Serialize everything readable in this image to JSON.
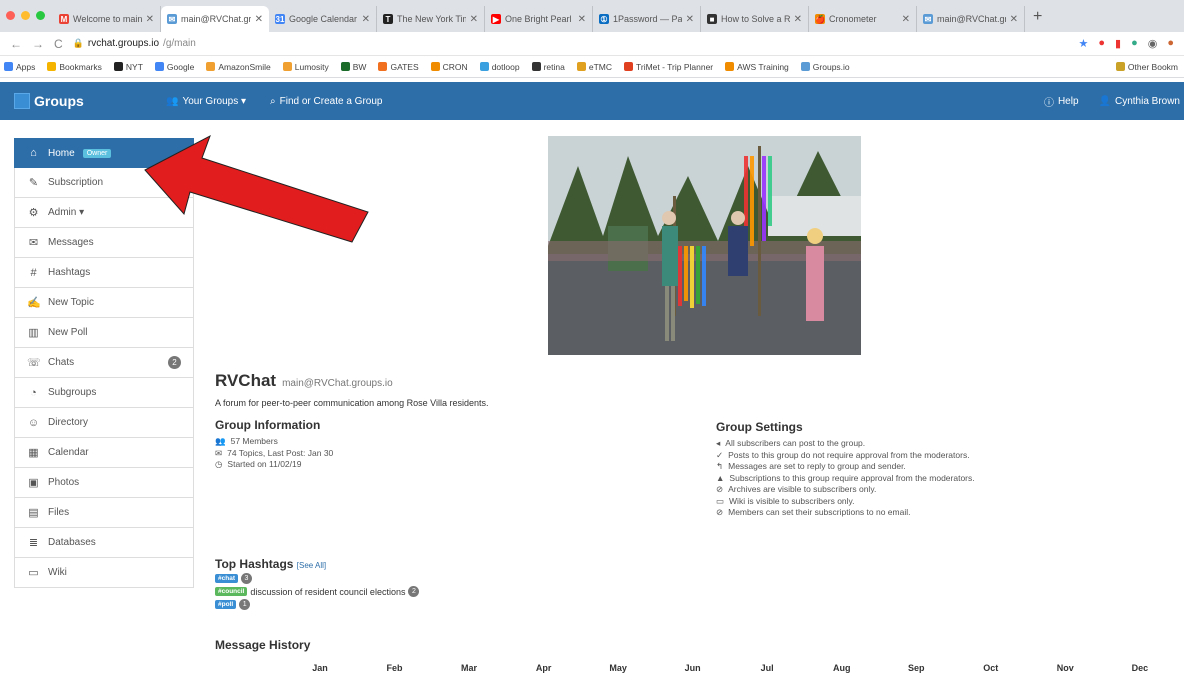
{
  "browser": {
    "tabs": [
      {
        "title": "Welcome to main@",
        "fav": "M",
        "color": "#ea4335",
        "active": false
      },
      {
        "title": "main@RVChat.gro",
        "fav": "✉",
        "color": "#5b9bd5",
        "active": true
      },
      {
        "title": "Google Calendar -",
        "fav": "31",
        "color": "#4285f4",
        "active": false
      },
      {
        "title": "The New York Tim",
        "fav": "T",
        "color": "#222222",
        "active": false
      },
      {
        "title": "One Bright Pearl -",
        "fav": "▶",
        "color": "#ff0000",
        "active": false
      },
      {
        "title": "1Password — Pass",
        "fav": "①",
        "color": "#0a6dc2",
        "active": false
      },
      {
        "title": "How to Solve a Ru",
        "fav": "■",
        "color": "#333333",
        "active": false
      },
      {
        "title": "Cronometer",
        "fav": "🍎",
        "color": "#f08c00",
        "active": false
      },
      {
        "title": "main@RVChat.gro",
        "fav": "✉",
        "color": "#5b9bd5",
        "active": false
      }
    ],
    "url_host": "rvchat.groups.io",
    "url_path": "/g/main",
    "bookmarks": [
      {
        "label": "Apps",
        "color": "#4285f4"
      },
      {
        "label": "Bookmarks",
        "color": "#f4b400"
      },
      {
        "label": "NYT",
        "color": "#222222"
      },
      {
        "label": "Google",
        "color": "#4285f4"
      },
      {
        "label": "AmazonSmile",
        "color": "#f0a030"
      },
      {
        "label": "Lumosity",
        "color": "#f0a030"
      },
      {
        "label": "BW",
        "color": "#1a6a2a"
      },
      {
        "label": "GATES",
        "color": "#f07020"
      },
      {
        "label": "CRON",
        "color": "#f08c00"
      },
      {
        "label": "dotloop",
        "color": "#3aa0e0"
      },
      {
        "label": "retina",
        "color": "#333333"
      },
      {
        "label": "eTMC",
        "color": "#e0a020"
      },
      {
        "label": "TriMet - Trip Planner",
        "color": "#e04020"
      },
      {
        "label": "AWS Training",
        "color": "#f08c00"
      },
      {
        "label": "Groups.io",
        "color": "#5b9bd5"
      }
    ],
    "other_bookmarks": "Other Bookm"
  },
  "nav": {
    "logo": "Groups",
    "your_groups": "Your Groups ▾",
    "find_create": "Find or Create a Group",
    "help": "Help",
    "user": "Cynthia Brown"
  },
  "sidebar": {
    "items": [
      {
        "label": "Home",
        "icon": "home-icon",
        "glyph": "⌂",
        "badge": "Owner",
        "active": true
      },
      {
        "label": "Subscription",
        "icon": "pencil-icon",
        "glyph": "✎"
      },
      {
        "label": "Admin ▾",
        "icon": "cog-icon",
        "glyph": "⚙"
      },
      {
        "label": "Messages",
        "icon": "comments-icon",
        "glyph": "✉"
      },
      {
        "label": "Hashtags",
        "icon": "hashtag-icon",
        "glyph": "#"
      },
      {
        "label": "New Topic",
        "icon": "edit-icon",
        "glyph": "✍"
      },
      {
        "label": "New Poll",
        "icon": "chart-icon",
        "glyph": "▥"
      },
      {
        "label": "Chats",
        "icon": "chat-icon",
        "glyph": "☏",
        "count": "2"
      },
      {
        "label": "Subgroups",
        "icon": "pie-icon",
        "glyph": "◔"
      },
      {
        "label": "Directory",
        "icon": "users-icon",
        "glyph": "☺"
      },
      {
        "label": "Calendar",
        "icon": "calendar-icon",
        "glyph": "▦"
      },
      {
        "label": "Photos",
        "icon": "photo-icon",
        "glyph": "▣"
      },
      {
        "label": "Files",
        "icon": "files-icon",
        "glyph": "▤"
      },
      {
        "label": "Databases",
        "icon": "database-icon",
        "glyph": "≣"
      },
      {
        "label": "Wiki",
        "icon": "wiki-icon",
        "glyph": "▭"
      }
    ]
  },
  "group": {
    "name": "RVChat",
    "email": "main@RVChat.groups.io",
    "description": "A forum for peer-to-peer communication among Rose Villa residents.",
    "info_heading": "Group Information",
    "members": "57 Members",
    "topics": "74 Topics, Last Post: Jan 30",
    "started": "Started on 11/02/19",
    "settings_heading": "Group Settings",
    "settings": [
      {
        "text": "All subscribers can post to the group.",
        "icon": "bullhorn-icon",
        "glyph": "◂"
      },
      {
        "text": "Posts to this group do not require approval from the moderators.",
        "icon": "check-icon",
        "glyph": "✓"
      },
      {
        "text": "Messages are set to reply to group and sender.",
        "icon": "reply-icon",
        "glyph": "↰"
      },
      {
        "text": "Subscriptions to this group require approval from the moderators.",
        "icon": "lock-icon",
        "glyph": "▲"
      },
      {
        "text": "Archives are visible to subscribers only.",
        "icon": "ban-icon",
        "glyph": "⊘"
      },
      {
        "text": "Wiki is visible to subscribers only.",
        "icon": "wiki-icon",
        "glyph": "▭"
      },
      {
        "text": "Members can set their subscriptions to no email.",
        "icon": "ban-icon",
        "glyph": "⊘"
      }
    ]
  },
  "hashtags": {
    "heading": "Top Hashtags",
    "see_all": "[See All]",
    "items": [
      {
        "tag": "#chat",
        "color": "#3a8fd4",
        "desc": "",
        "count": "3"
      },
      {
        "tag": "#council",
        "color": "#5cb85c",
        "desc": "discussion of resident council elections",
        "count": "2"
      },
      {
        "tag": "#poll",
        "color": "#3a8fd4",
        "desc": "",
        "count": "1"
      }
    ]
  },
  "history": {
    "heading": "Message History",
    "months": [
      "Jan",
      "Feb",
      "Mar",
      "Apr",
      "May",
      "Jun",
      "Jul",
      "Aug",
      "Sep",
      "Oct",
      "Nov",
      "Dec"
    ]
  }
}
